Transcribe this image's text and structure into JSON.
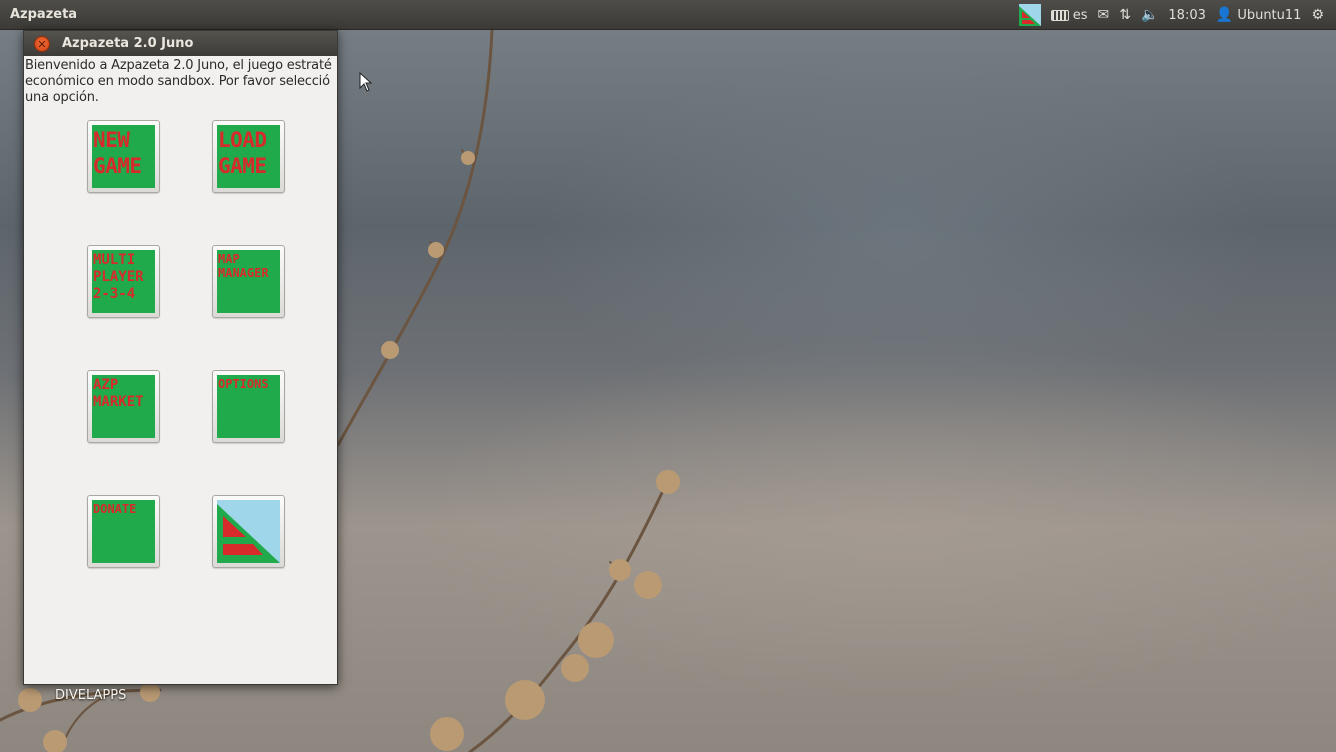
{
  "panel": {
    "app_title": "Azpazeta",
    "keyboard_layout": "es",
    "time": "18:03",
    "user": "Ubuntu11",
    "icons": [
      "azpazeta-tray-icon",
      "keyboard-icon",
      "mail-icon",
      "network-icon",
      "volume-icon",
      "user-icon",
      "gear-icon"
    ]
  },
  "window": {
    "title": "Azpazeta 2.0 Juno",
    "welcome_line1": "Bienvenido a Azpazeta 2.0 Juno, el juego estraté",
    "welcome_line2": "económico en modo sandbox. Por favor selecció",
    "welcome_line3": "una opción.",
    "buttons": {
      "new_game": "NEW\nGAME",
      "load_game": "LOAD\nGAME",
      "multiplayer": "MULTI\nPLAYER\n2-3-4",
      "map_manager": "MAP\nMANAGER",
      "azp_market": "AZP\nMARKET",
      "options": "OPTIONS",
      "donate": "DONATE"
    }
  },
  "desktop": {
    "label": "DIVELAPPS"
  },
  "colors": {
    "button_green": "#21aa4b",
    "button_text_red": "#d72b2b",
    "logo_sky": "#9fd6ea",
    "close_orange": "#e2561f"
  }
}
